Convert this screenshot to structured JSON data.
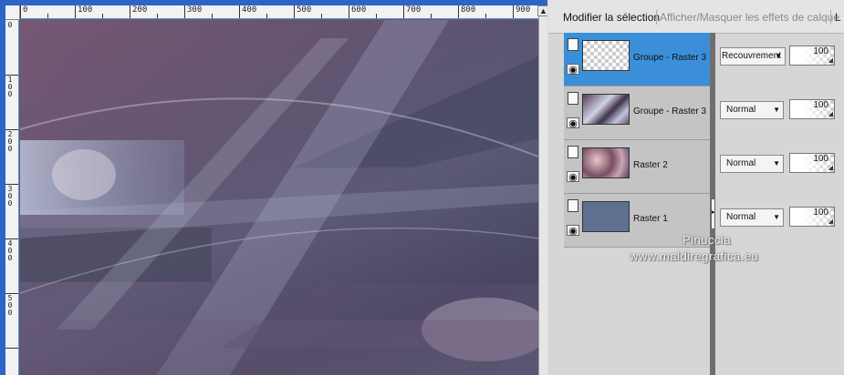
{
  "ruler": {
    "h_labels": [
      "0",
      "100",
      "200",
      "300",
      "400",
      "500",
      "600",
      "700",
      "800",
      "900"
    ],
    "v_labels": [
      "0",
      "1\n0\n0",
      "2\n0\n0",
      "3\n0\n0",
      "4\n0\n0",
      "5\n0\n0"
    ]
  },
  "panel": {
    "tab_active": "Modifier la sélection",
    "tab_secondary": "Afficher/Masquer les effets de calque",
    "tab_cut": "L"
  },
  "layers": [
    {
      "name": "Groupe - Raster 3",
      "blend": "Recouvrement",
      "opacity": "100",
      "selected": true
    },
    {
      "name": "Groupe - Raster 3",
      "blend": "Normal",
      "opacity": "100",
      "selected": false
    },
    {
      "name": "Raster 2",
      "blend": "Normal",
      "opacity": "100",
      "selected": false
    },
    {
      "name": "Raster 1",
      "blend": "Normal",
      "opacity": "100",
      "selected": false
    }
  ],
  "icons": {
    "eye": "eye-icon",
    "lock": "layer-link-icon",
    "dropdown": "chevron-down-icon",
    "expand": "chevron-right-icon",
    "scroll_up": "arrow-up-icon"
  },
  "watermark": {
    "line1": "Pinuccia",
    "line2": "www.maldiregrafica.eu"
  },
  "colors": {
    "selection": "#3b8fd9",
    "raster1_fill": "#5f6f8f",
    "editor_bg": "#2c64c8"
  }
}
